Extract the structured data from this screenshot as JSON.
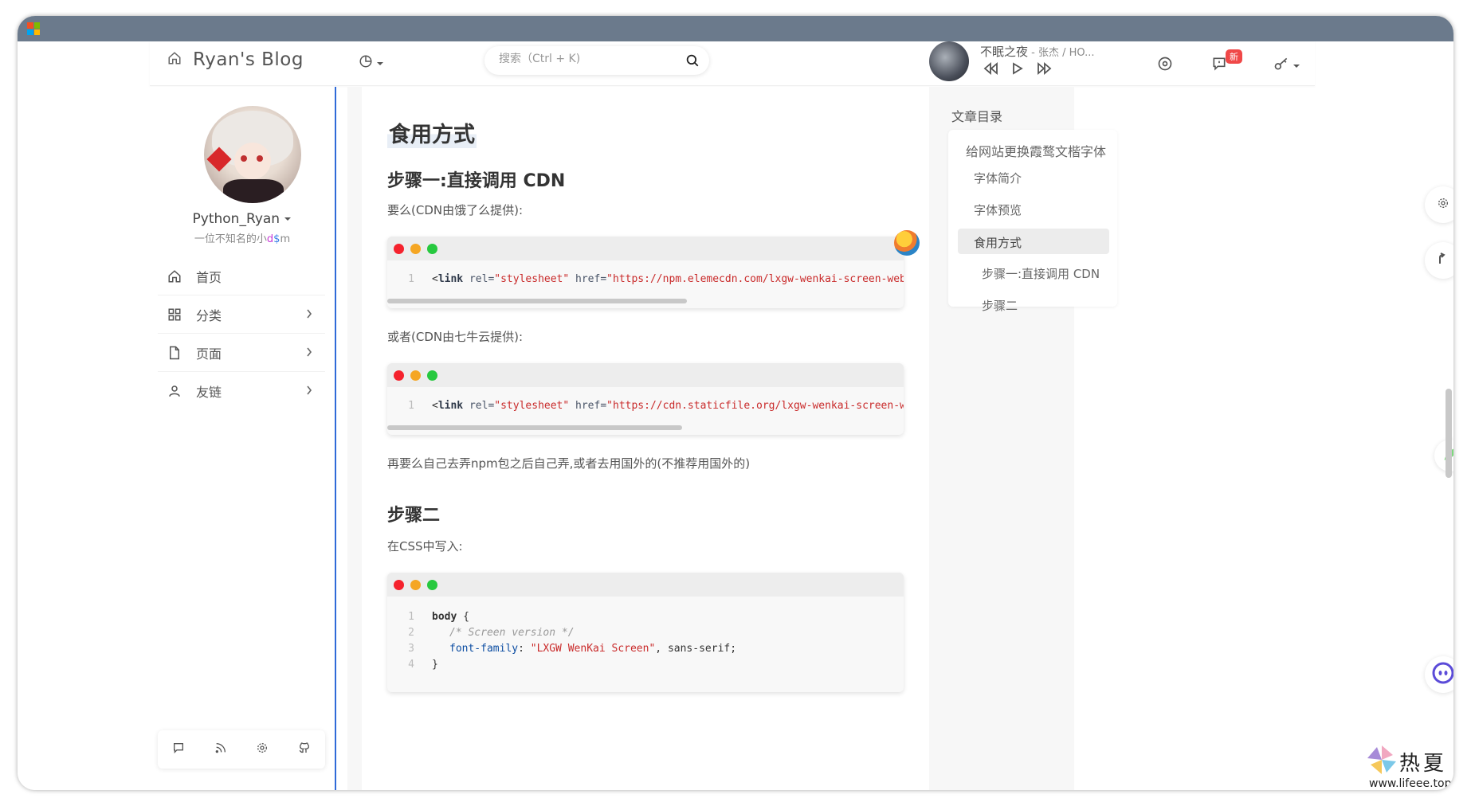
{
  "window": {
    "os_logo_colors": [
      "#f25022",
      "#7fba00",
      "#00a4ef",
      "#ffb900"
    ]
  },
  "header": {
    "site_title": "Ryan's Blog",
    "search_placeholder": "搜索（Ctrl + K)",
    "player": {
      "track": "不眠之夜",
      "artist": " - 张杰 / HO..."
    },
    "message_badge": "新"
  },
  "profile": {
    "name": "Python_Ryan",
    "motto_prefix": "一位不知名的小",
    "motto_d": "d",
    "motto_s": "$",
    "motto_m": "m"
  },
  "sidebar": {
    "items": [
      {
        "label": "首页",
        "icon": "home-icon",
        "has_chevron": false
      },
      {
        "label": "分类",
        "icon": "grid-icon",
        "has_chevron": true
      },
      {
        "label": "页面",
        "icon": "file-icon",
        "has_chevron": true
      },
      {
        "label": "友链",
        "icon": "user-icon",
        "has_chevron": true
      }
    ],
    "tools": [
      "chat-icon",
      "rss-icon",
      "settings-icon",
      "github-icon"
    ]
  },
  "article": {
    "h2": "食用方式",
    "step1_title": "步骤一:直接调用 CDN",
    "p1": "要么(CDN由饿了么提供):",
    "code1": {
      "ln": "1",
      "open": "<",
      "tag": "link",
      "attr1": " rel=",
      "val1": "\"stylesheet\"",
      "attr2": " href=",
      "val2": "\"https://npm.elemecdn.com/lxgw-wenkai-screen-webfo"
    },
    "p2": "或者(CDN由七牛云提供):",
    "code2": {
      "ln": "1",
      "open": "<",
      "tag": "link",
      "attr1": " rel=",
      "val1": "\"stylesheet\"",
      "attr2": " href=",
      "val2": "\"https://cdn.staticfile.org/lxgw-wenkai-screen-web"
    },
    "p3": "再要么自己去弄npm包之后自己弄,或者去用国外的(不推荐用国外的)",
    "step2_title": "步骤二",
    "p4": "在CSS中写入:",
    "code3": {
      "ln1": "1",
      "ln2": "2",
      "ln3": "3",
      "ln4": "4",
      "l1_sel": "body",
      "l1_rest": " {",
      "l2": "/* Screen version */",
      "l3_prop": "font-family",
      "l3_colon": ": ",
      "l3_str": "\"LXGW WenKai Screen\"",
      "l3_rest": ", sans-serif;",
      "l4": "}"
    }
  },
  "toc": {
    "title": "文章目录",
    "items": [
      "给网站更换霞鹜文楷字体",
      "字体简介",
      "字体预览",
      "食用方式",
      "步骤一:直接调用 CDN",
      "步骤二"
    ],
    "active_index": 3
  },
  "watermark": {
    "cn": "热夏",
    "url": "www.lifeee.top"
  },
  "colors": {
    "accent": "#2f6ad8",
    "dot_red": "#f5222d",
    "dot_yellow": "#f5a623",
    "dot_green": "#27c93f",
    "badge": "#f04848"
  }
}
